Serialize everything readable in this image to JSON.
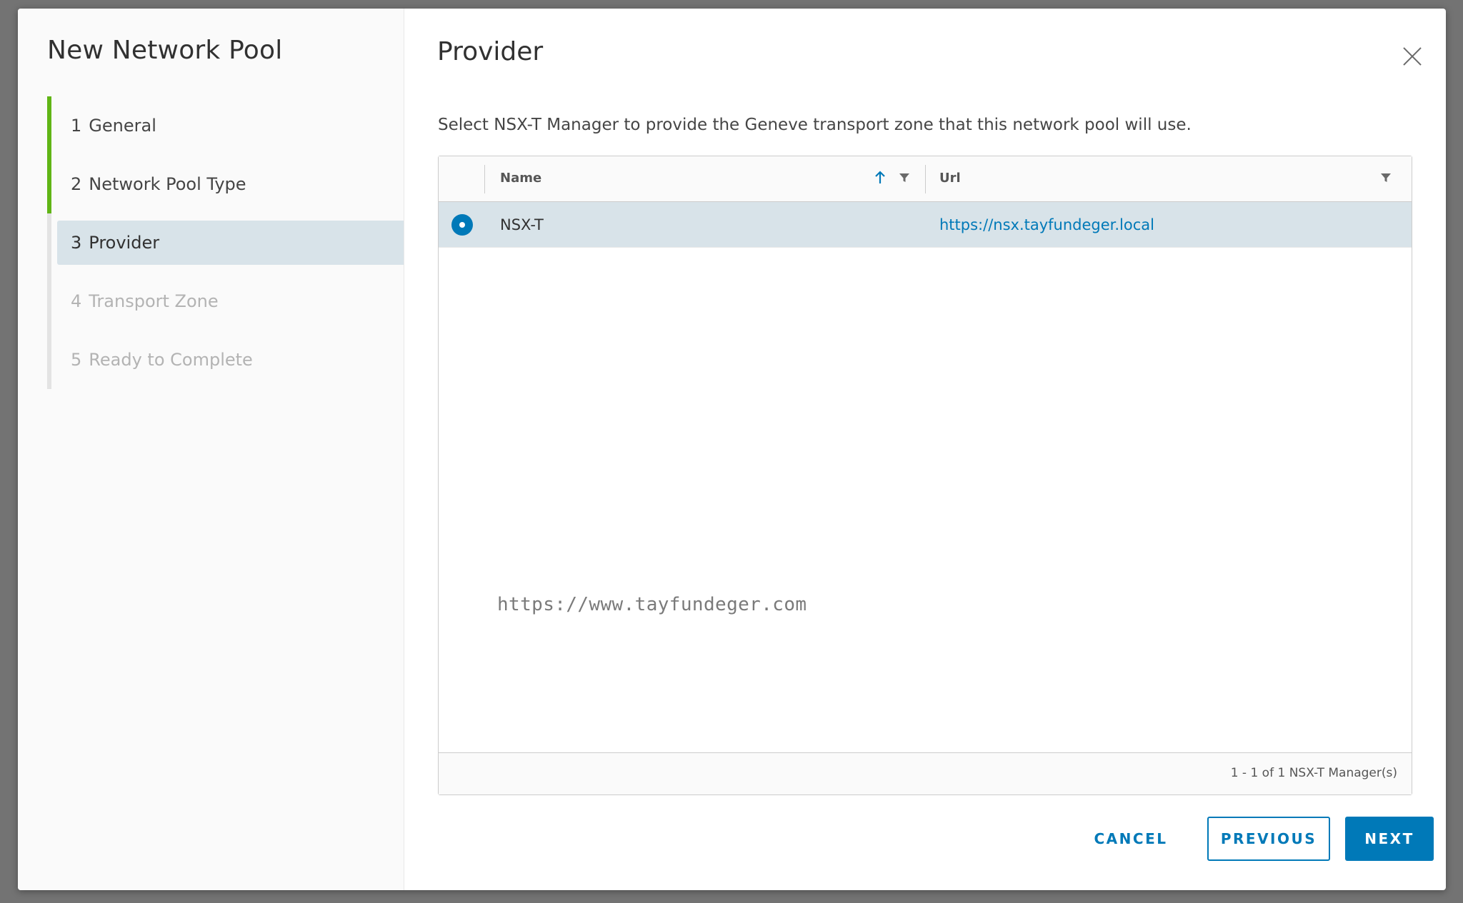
{
  "wizard": {
    "title": "New Network Pool",
    "steps": [
      {
        "num": "1",
        "label": "General",
        "state": "done"
      },
      {
        "num": "2",
        "label": "Network Pool Type",
        "state": "done"
      },
      {
        "num": "3",
        "label": "Provider",
        "state": "active"
      },
      {
        "num": "4",
        "label": "Transport Zone",
        "state": "disabled"
      },
      {
        "num": "5",
        "label": "Ready to Complete",
        "state": "disabled"
      }
    ]
  },
  "page": {
    "title": "Provider",
    "description": "Select NSX-T Manager to provide the Geneve transport zone that this network pool will use.",
    "close_icon": "close-icon"
  },
  "grid": {
    "columns": [
      {
        "label": "Name",
        "sorted": "ascending",
        "filterable": true
      },
      {
        "label": "Url",
        "filterable": true
      }
    ],
    "rows": [
      {
        "name": "NSX-T",
        "url": "https://nsx.tayfundeger.local",
        "selected": true
      }
    ],
    "footer": "1 - 1 of 1 NSX-T Manager(s)"
  },
  "watermark": "https://www.tayfundeger.com",
  "buttons": {
    "cancel": "CANCEL",
    "previous": "PREVIOUS",
    "next": "NEXT"
  },
  "colors": {
    "accent": "#0079b8",
    "step_done": "#60b515",
    "selected_row": "#d8e3e9"
  }
}
